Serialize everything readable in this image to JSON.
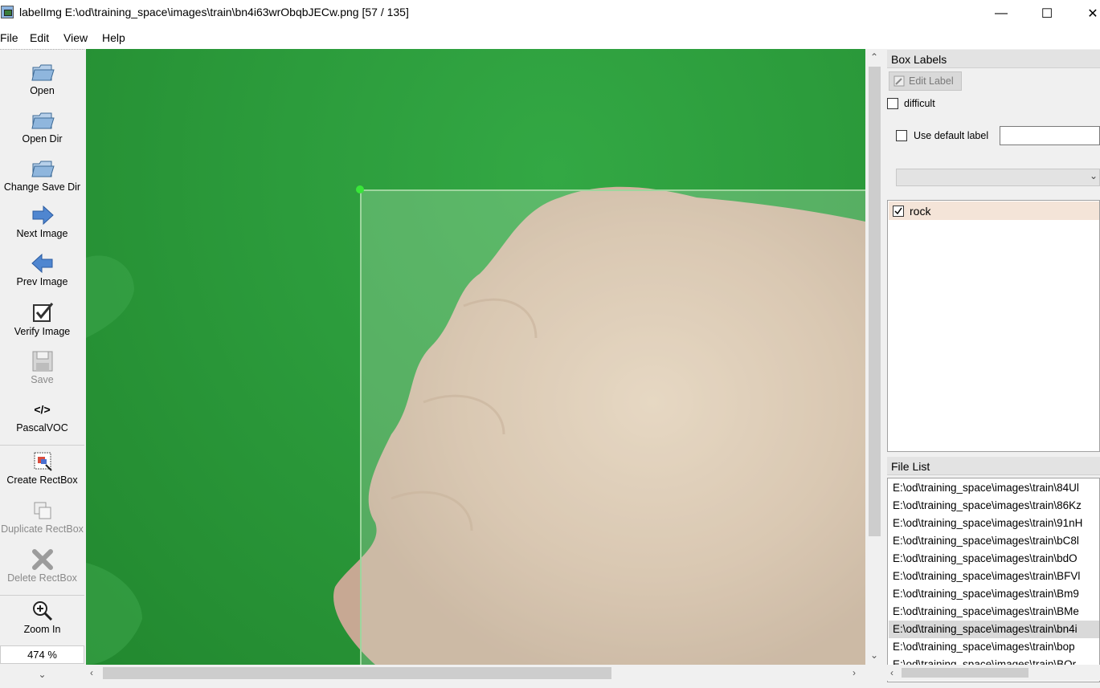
{
  "window": {
    "title": "labelImg E:\\od\\training_space\\images\\train\\bn4i63wrObqbJECw.png [57 / 135]",
    "minimize": "—",
    "maximize": "☐",
    "close": "✕"
  },
  "menu": [
    "File",
    "Edit",
    "View",
    "Help"
  ],
  "toolbar": {
    "open": "Open",
    "open_dir": "Open Dir",
    "change_save_dir": "Change Save Dir",
    "next_image": "Next Image",
    "prev_image": "Prev Image",
    "verify_image": "Verify Image",
    "save": "Save",
    "format": "PascalVOC",
    "format_icon": "</>",
    "create_rectbox": "Create RectBox",
    "duplicate_rectbox": "Duplicate RectBox",
    "delete_rectbox": "Delete RectBox",
    "zoom_in": "Zoom In",
    "zoom_value": "474 %",
    "more": "⌄"
  },
  "box_labels": {
    "title": "Box Labels",
    "edit_label": "Edit Label",
    "difficult": "difficult",
    "use_default_label": "Use default label",
    "default_label_value": "",
    "labels": [
      {
        "name": "rock",
        "checked": true
      }
    ]
  },
  "file_list": {
    "title": "File List",
    "files": [
      "E:\\od\\training_space\\images\\train\\84Ul",
      "E:\\od\\training_space\\images\\train\\86Kz",
      "E:\\od\\training_space\\images\\train\\91nH",
      "E:\\od\\training_space\\images\\train\\bC8l",
      "E:\\od\\training_space\\images\\train\\bdO",
      "E:\\od\\training_space\\images\\train\\BFVl",
      "E:\\od\\training_space\\images\\train\\Bm9",
      "E:\\od\\training_space\\images\\train\\BMe",
      "E:\\od\\training_space\\images\\train\\bn4i",
      "E:\\od\\training_space\\images\\train\\bop",
      "E:\\od\\training_space\\images\\train\\BQr"
    ],
    "selected_index": 8
  },
  "colors": {
    "canvas_green": "#2c9c3c",
    "bbox_outline": "#9ed69e",
    "handle": "#39e639",
    "selected_label": "#f4e4d8"
  }
}
